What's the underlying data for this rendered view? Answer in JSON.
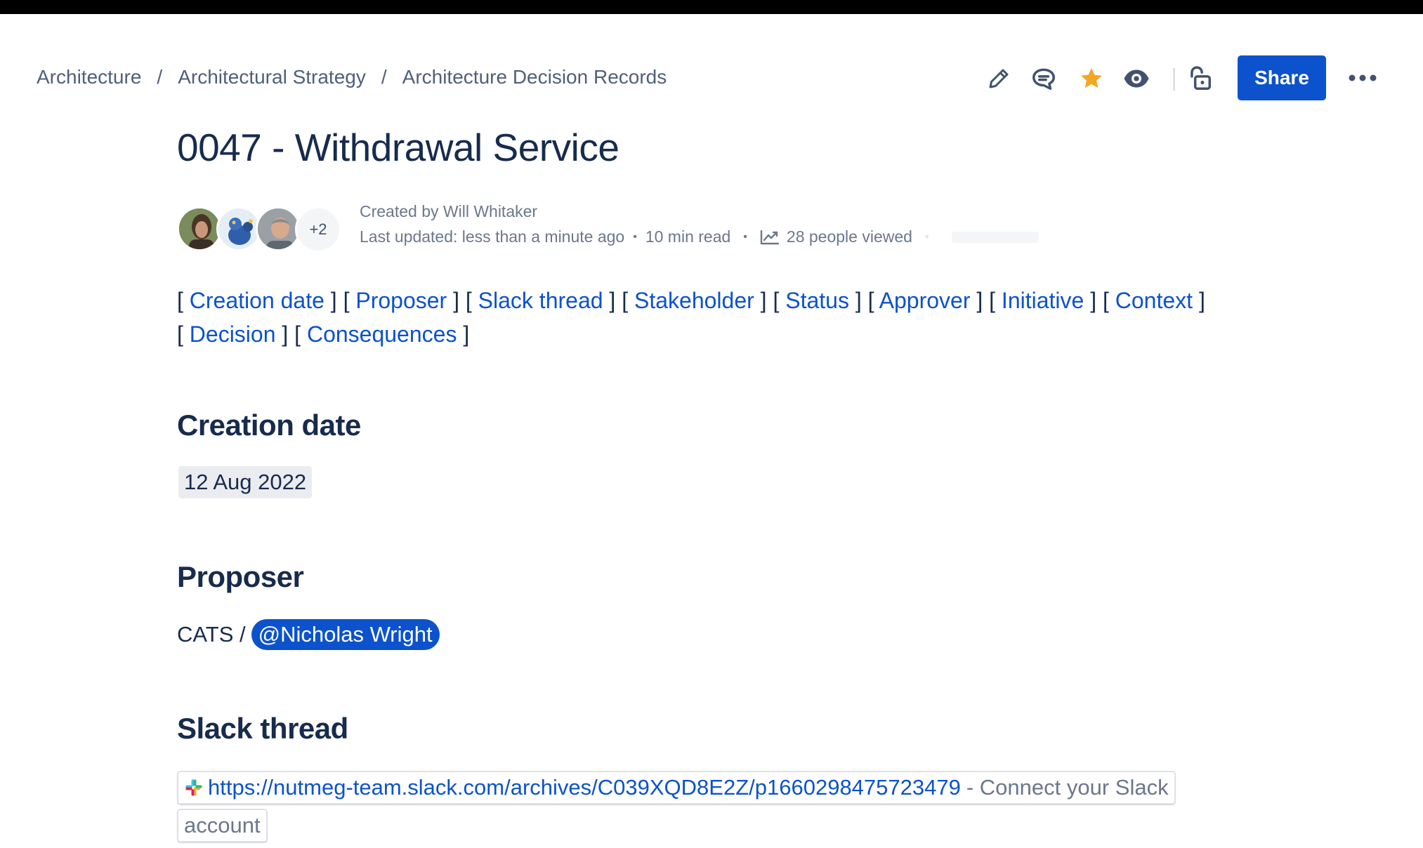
{
  "breadcrumb": [
    "Architecture",
    "Architectural Strategy",
    "Architecture Decision Records"
  ],
  "breadcrumb_separator": "/",
  "toolbar": {
    "share_label": "Share",
    "icons": [
      "edit-pencil-icon",
      "comment-icon",
      "star-icon",
      "watch-eye-icon",
      "unlock-icon",
      "more-icon"
    ],
    "star_color": "#F5A623",
    "accent": "#0C52CC"
  },
  "page": {
    "title": "0047 - Withdrawal Service"
  },
  "byline": {
    "more_contributors": "+2",
    "created_by": "Created by Will Whitaker",
    "last_updated": "Last updated: less than a minute ago",
    "read_time": "10 min read",
    "views": "28 people viewed"
  },
  "toc": [
    "Creation date",
    "Proposer",
    "Slack thread",
    "Stakeholder",
    "Status",
    "Approver",
    "Initiative",
    "Context",
    "Decision",
    "Consequences"
  ],
  "sections": {
    "creation_date": {
      "heading": "Creation date",
      "value": "12 Aug 2022"
    },
    "proposer": {
      "heading": "Proposer",
      "prefix": "CATS /",
      "mention": "@Nicholas Wright"
    },
    "slack_thread": {
      "heading": "Slack thread",
      "url": "https://nutmeg-team.slack.com/archives/C039XQD8E2Z/p1660298475723479",
      "suffix": "- Connect your Slack",
      "suffix_line2": "account"
    }
  }
}
